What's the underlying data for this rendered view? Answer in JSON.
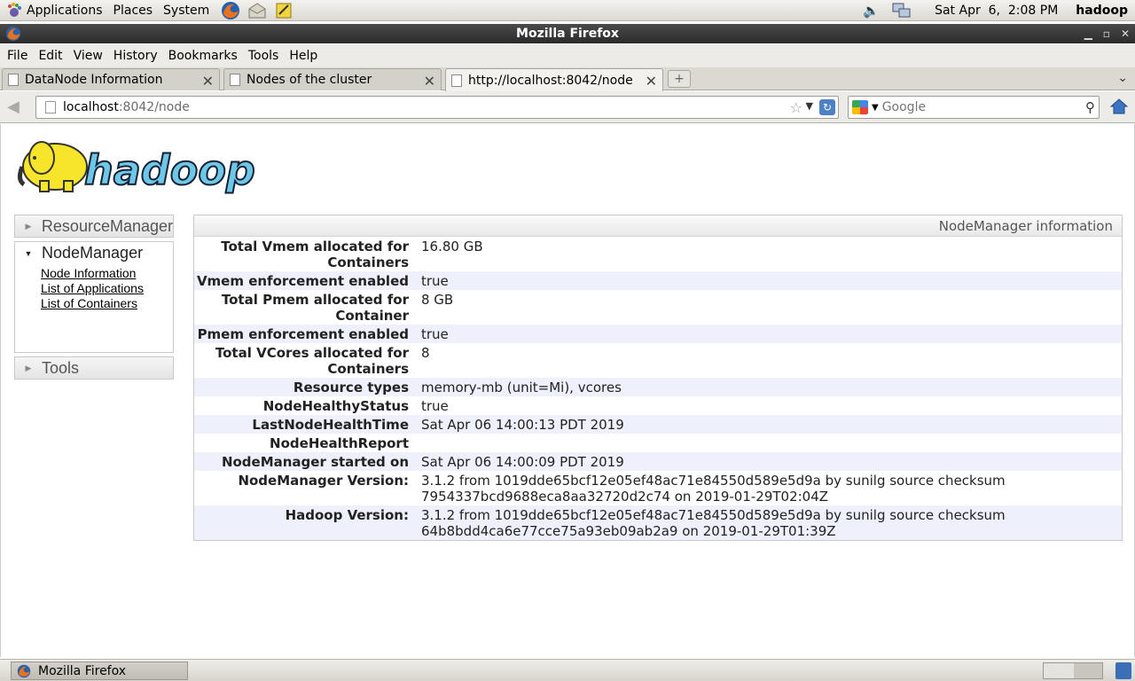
{
  "panel": {
    "applications": "Applications",
    "places": "Places",
    "system": "System",
    "clock": "Sat Apr  6,  2:08 PM",
    "user": "hadoop"
  },
  "window": {
    "title": "Mozilla Firefox"
  },
  "menubar": {
    "file": "File",
    "edit": "Edit",
    "view": "View",
    "history": "History",
    "bookmarks": "Bookmarks",
    "tools": "Tools",
    "help": "Help"
  },
  "tabs": [
    {
      "label": "DataNode Information"
    },
    {
      "label": "Nodes of the cluster"
    },
    {
      "label": "http://localhost:8042/node"
    }
  ],
  "nav": {
    "url_host": "localhost",
    "url_rest": ":8042/node",
    "search_placeholder": "Google"
  },
  "sidebar": {
    "resource_manager": "ResourceManager",
    "node_manager": "NodeManager",
    "links": [
      "Node Information",
      "List of Applications",
      "List of Containers"
    ],
    "tools": "Tools"
  },
  "info": {
    "title": "NodeManager information",
    "rows": [
      {
        "key": "Total Vmem allocated for Containers",
        "value": "16.80 GB"
      },
      {
        "key": "Vmem enforcement enabled",
        "value": "true"
      },
      {
        "key": "Total Pmem allocated for Container",
        "value": "8 GB"
      },
      {
        "key": "Pmem enforcement enabled",
        "value": "true"
      },
      {
        "key": "Total VCores allocated for Containers",
        "value": "8"
      },
      {
        "key": "Resource types",
        "value": "memory-mb (unit=Mi), vcores"
      },
      {
        "key": "NodeHealthyStatus",
        "value": "true"
      },
      {
        "key": "LastNodeHealthTime",
        "value": "Sat Apr 06 14:00:13 PDT 2019"
      },
      {
        "key": "NodeHealthReport",
        "value": ""
      },
      {
        "key": "NodeManager started on",
        "value": "Sat Apr 06 14:00:09 PDT 2019"
      },
      {
        "key": "NodeManager Version:",
        "value": "3.1.2 from 1019dde65bcf12e05ef48ac71e84550d589e5d9a by sunilg source checksum 7954337bcd9688eca8aa32720d2c74 on 2019-01-29T02:04Z"
      },
      {
        "key": "Hadoop Version:",
        "value": "3.1.2 from 1019dde65bcf12e05ef48ac71e84550d589e5d9a by sunilg source checksum 64b8bdd4ca6e77cce75a93eb09ab2a9 on 2019-01-29T01:39Z"
      }
    ]
  },
  "taskbar": {
    "window_button": "Mozilla Firefox"
  }
}
